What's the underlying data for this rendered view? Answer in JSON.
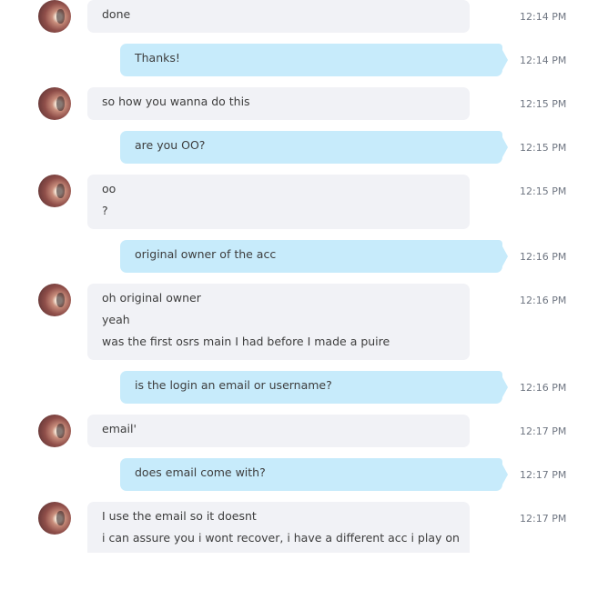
{
  "messages": [
    {
      "from": "them",
      "time": "12:14 PM",
      "lines": [
        "done"
      ]
    },
    {
      "from": "me",
      "time": "12:14 PM",
      "lines": [
        "Thanks!"
      ]
    },
    {
      "from": "them",
      "time": "12:15 PM",
      "lines": [
        "so how you wanna do this"
      ]
    },
    {
      "from": "me",
      "time": "12:15 PM",
      "lines": [
        "are you OO?"
      ]
    },
    {
      "from": "them",
      "time": "12:15 PM",
      "lines": [
        "oo",
        "?"
      ]
    },
    {
      "from": "me",
      "time": "12:16 PM",
      "lines": [
        "original owner of the acc"
      ]
    },
    {
      "from": "them",
      "time": "12:16 PM",
      "lines": [
        "oh original owner",
        "yeah",
        "was the first osrs main I had before I made a puire"
      ]
    },
    {
      "from": "me",
      "time": "12:16 PM",
      "lines": [
        "is the login an email or username?"
      ]
    },
    {
      "from": "them",
      "time": "12:17 PM",
      "lines": [
        "email'"
      ]
    },
    {
      "from": "me",
      "time": "12:17 PM",
      "lines": [
        "does email come with?"
      ]
    },
    {
      "from": "them",
      "time": "12:17 PM",
      "lines": [
        "I use the email so it doesnt",
        "i can assure you i wont recover, i have a different acc i play on"
      ]
    }
  ]
}
